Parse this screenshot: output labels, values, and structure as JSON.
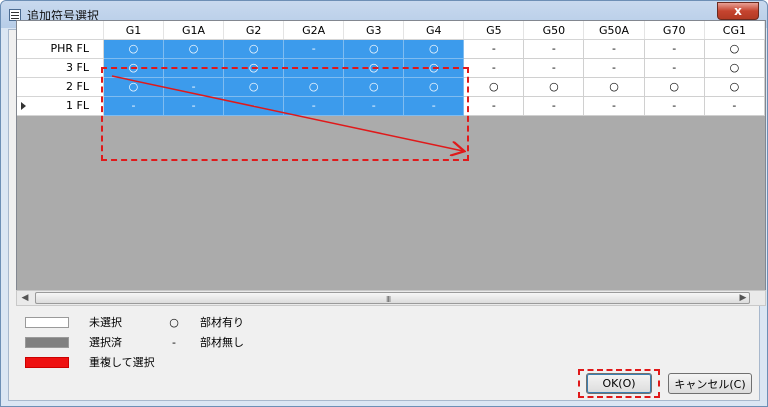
{
  "window": {
    "title": "追加符号選択",
    "close_label": "x"
  },
  "grid": {
    "columns": [
      "G1",
      "G1A",
      "G2",
      "G2A",
      "G3",
      "G4",
      "G5",
      "G50",
      "G50A",
      "G70",
      "CG1"
    ],
    "rows": [
      {
        "label": "PHR FL",
        "cells": [
          "○",
          "○",
          "○",
          "-",
          "○",
          "○",
          "-",
          "-",
          "-",
          "-",
          "○"
        ],
        "selected_through": 6
      },
      {
        "label": "3 FL",
        "cells": [
          "○",
          "-",
          "○",
          "-",
          "○",
          "○",
          "-",
          "-",
          "-",
          "-",
          "○"
        ],
        "selected_through": 6
      },
      {
        "label": "2 FL",
        "cells": [
          "○",
          "-",
          "○",
          "○",
          "○",
          "○",
          "○",
          "○",
          "○",
          "○",
          "○"
        ],
        "selected_through": 6
      },
      {
        "label": "1 FL",
        "cells": [
          "-",
          "-",
          "-",
          "-",
          "-",
          "-",
          "-",
          "-",
          "-",
          "-",
          "-"
        ],
        "selected_through": 6,
        "current": true
      }
    ]
  },
  "scrollbar": {
    "grip": "III"
  },
  "legend": {
    "unselected": "未選択",
    "selected": "選択済",
    "overlap": "重複して選択",
    "present_symbol": "○",
    "present": "部材有り",
    "absent_symbol": "-",
    "absent": "部材無し",
    "colors": {
      "unselected": "#ffffff",
      "selected": "#808080",
      "overlap": "#ee1111"
    }
  },
  "buttons": {
    "ok": "OK(O)",
    "cancel": "キャンセル(C)"
  },
  "annotation_color": "#e0191a"
}
